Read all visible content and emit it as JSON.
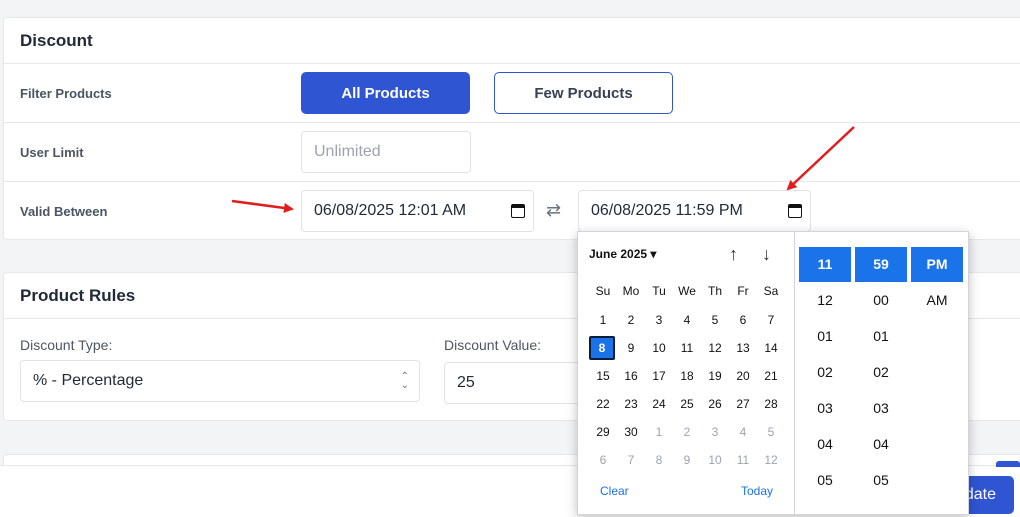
{
  "discount": {
    "title": "Discount",
    "filter_label": "Filter Products",
    "all_products_label": "All Products",
    "few_products_label": "Few Products",
    "user_limit_label": "User Limit",
    "user_limit_placeholder": "Unlimited",
    "valid_between_label": "Valid Between",
    "start_datetime": "06/08/2025 12:01 AM",
    "end_datetime": "06/08/2025 11:59 PM"
  },
  "rules": {
    "title": "Product Rules",
    "discount_type_label": "Discount Type:",
    "discount_type_value": "% - Percentage",
    "discount_value_label": "Discount Value:",
    "discount_value": "25"
  },
  "footer": {
    "update_label": "date"
  },
  "picker": {
    "month_label": "June 2025",
    "dropdown_glyph": "▾",
    "up_arrow": "↑",
    "down_arrow": "↓",
    "weekdays": [
      "Su",
      "Mo",
      "Tu",
      "We",
      "Th",
      "Fr",
      "Sa"
    ],
    "weeks": [
      [
        "1",
        "2",
        "3",
        "4",
        "5",
        "6",
        "7"
      ],
      [
        "8",
        "9",
        "10",
        "11",
        "12",
        "13",
        "14"
      ],
      [
        "15",
        "16",
        "17",
        "18",
        "19",
        "20",
        "21"
      ],
      [
        "22",
        "23",
        "24",
        "25",
        "26",
        "27",
        "28"
      ],
      [
        "29",
        "30",
        "1",
        "2",
        "3",
        "4",
        "5"
      ],
      [
        "6",
        "7",
        "8",
        "9",
        "10",
        "11",
        "12"
      ]
    ],
    "selected_day": "8",
    "clear_label": "Clear",
    "today_label": "Today",
    "hours": [
      "11",
      "12",
      "01",
      "02",
      "03",
      "04",
      "05"
    ],
    "minutes": [
      "59",
      "00",
      "01",
      "02",
      "03",
      "04",
      "05"
    ],
    "meridiem": [
      "PM",
      "AM"
    ]
  },
  "colors": {
    "primary": "#3055d3",
    "picker_accent": "#1a73e8",
    "annotation_arrow": "#e01e1e"
  }
}
